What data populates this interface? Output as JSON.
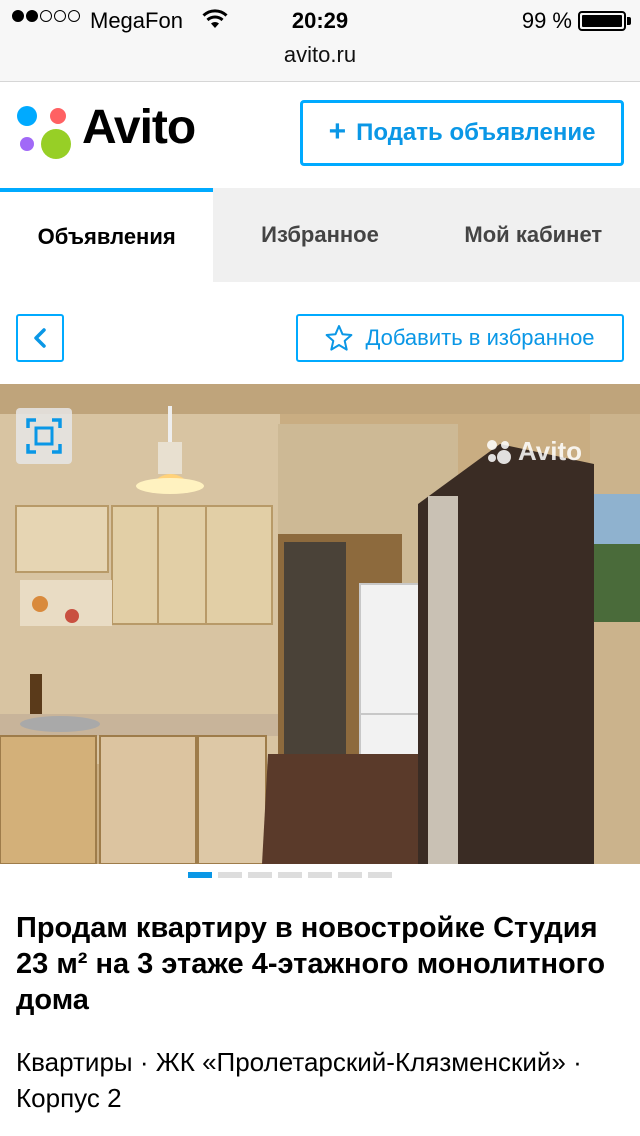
{
  "status_bar": {
    "carrier": "MegaFon",
    "time": "20:29",
    "battery": "99 %",
    "signal_bars": 2,
    "signal_total": 5
  },
  "browser": {
    "url": "avito.ru"
  },
  "header": {
    "logo_text": "Avito",
    "post_ad_label": "Подать объявление"
  },
  "tabs": [
    {
      "label": "Объявления",
      "active": true
    },
    {
      "label": "Избранное",
      "active": false
    },
    {
      "label": "Мой кабинет",
      "active": false
    }
  ],
  "toolbar": {
    "add_favorite_label": "Добавить в избранное"
  },
  "gallery": {
    "watermark": "Avito",
    "current_photo": 1,
    "total_photos": 7
  },
  "listing": {
    "title": "Продам квартиру в новостройке Студия 23 м² на 3 этаже 4-этажного монолитного дома",
    "meta": "Квартиры · ЖК «Пролетарский-Клязменский» · Корпус 2"
  },
  "colors": {
    "accent": "#00aaff",
    "accent_text": "#0a97e6",
    "logo_blue": "#0af",
    "logo_red": "#ff6163",
    "logo_purple": "#a169f7",
    "logo_green": "#97cf26"
  }
}
